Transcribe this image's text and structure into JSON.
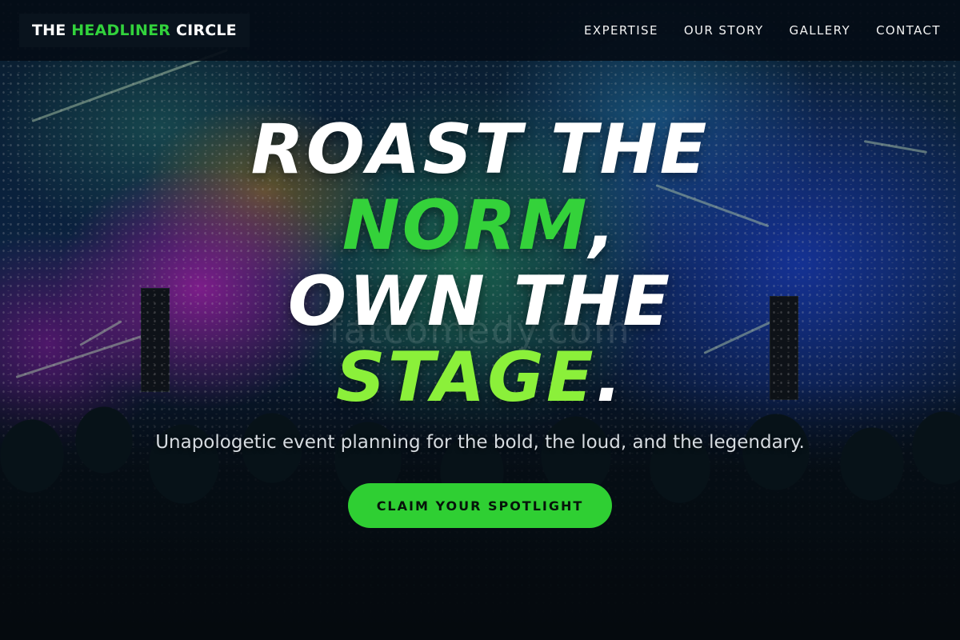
{
  "brand": {
    "name_part1": "THE",
    "name_accent": "HEADLINER",
    "name_part2": "CIRCLE",
    "accent_color": "#32d23c"
  },
  "nav": {
    "items": [
      {
        "label": "EXPERTISE"
      },
      {
        "label": "OUR STORY"
      },
      {
        "label": "GALLERY"
      },
      {
        "label": "CONTACT"
      }
    ]
  },
  "hero": {
    "line1": "ROAST THE",
    "line2_accent": "NORM",
    "line2_punct": ",",
    "line3": "OWN THE",
    "line4_accent": "STAGE",
    "line4_punct": ".",
    "subtitle": "Unapologetic event planning for the bold, the loud, and the legendary.",
    "cta_label": "CLAIM YOUR SPOTLIGHT",
    "watermark": "fatcomedy.com",
    "cta_color": "#2fcf33",
    "accent_color_2": "#8bf03a"
  }
}
